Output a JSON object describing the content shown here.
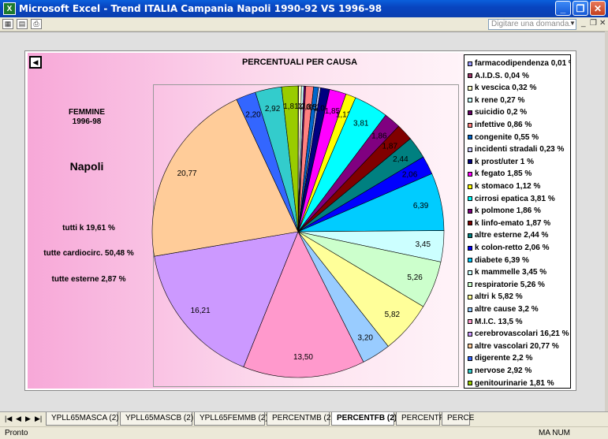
{
  "window": {
    "app_icon": "excel-icon",
    "title": "Microsoft Excel - Trend ITALIA Campania Napoli 1990-92 VS 1996-98",
    "buttons": [
      "minimize-icon",
      "restore-icon",
      "close-icon"
    ]
  },
  "toolbar": {
    "ask_placeholder": "Digitare una domanda.",
    "icons": [
      "excel-doc-icon",
      "print-preview-icon",
      "print-icon"
    ]
  },
  "chart": {
    "back_symbol": "◀",
    "title": "PERCENTUALI PER CAUSA",
    "sex_label": "FEMMINE",
    "period_label": "1996-98",
    "city": "Napoli",
    "summary": [
      "tutti k 19,61 %",
      "tutte cardiocirc. 50,48 %",
      "tutte esterne 2,87 %"
    ]
  },
  "chart_data": {
    "type": "pie",
    "title": "PERCENTUALI PER CAUSA",
    "slices": [
      {
        "label": "farmacodipendenza 0,01 %",
        "value": 0.01,
        "color": "#9999ff",
        "data_label": "0,01"
      },
      {
        "label": "A.I.D.S. 0,04 %",
        "value": 0.04,
        "color": "#993366",
        "data_label": "0,04"
      },
      {
        "label": "k vescica 0,32 %",
        "value": 0.32,
        "color": "#ffffcc",
        "data_label": "0,32"
      },
      {
        "label": "k rene 0,27 %",
        "value": 0.27,
        "color": "#ccffff",
        "data_label": "0,27"
      },
      {
        "label": "suicidio 0,2 %",
        "value": 0.2,
        "color": "#660066",
        "data_label": "0,20"
      },
      {
        "label": "infettive 0,86 %",
        "value": 0.86,
        "color": "#ff8080",
        "data_label": "0,86"
      },
      {
        "label": "congenite 0,55 %",
        "value": 0.55,
        "color": "#0066cc",
        "data_label": "0,55"
      },
      {
        "label": "incidenti stradali 0,23 %",
        "value": 0.23,
        "color": "#ccccff",
        "data_label": "0,23"
      },
      {
        "label": "k prost/uter 1 %",
        "value": 1.0,
        "color": "#000080",
        "data_label": "1,00"
      },
      {
        "label": "k fegato 1,85 %",
        "value": 1.85,
        "color": "#ff00ff",
        "data_label": "1,85"
      },
      {
        "label": "k stomaco 1,12 %",
        "value": 1.12,
        "color": "#ffff00",
        "data_label": "1,12"
      },
      {
        "label": "cirrosi epatica 3,81 %",
        "value": 3.81,
        "color": "#00ffff",
        "data_label": "3,81"
      },
      {
        "label": "k polmone 1,86 %",
        "value": 1.86,
        "color": "#800080",
        "data_label": "1,86"
      },
      {
        "label": "k linfo-emato 1,87 %",
        "value": 1.87,
        "color": "#800000",
        "data_label": "1,87"
      },
      {
        "label": "altre esterne 2,44 %",
        "value": 2.44,
        "color": "#008080",
        "data_label": "2,44"
      },
      {
        "label": "k colon-retto 2,06 %",
        "value": 2.06,
        "color": "#0000ff",
        "data_label": "2,06"
      },
      {
        "label": "diabete 6,39 %",
        "value": 6.39,
        "color": "#00ccff",
        "data_label": "6,39"
      },
      {
        "label": "k mammelle 3,45 %",
        "value": 3.45,
        "color": "#ccffff",
        "data_label": "3,45"
      },
      {
        "label": "respiratorie 5,26 %",
        "value": 5.26,
        "color": "#ccffcc",
        "data_label": "5,26"
      },
      {
        "label": "altri k 5,82 %",
        "value": 5.82,
        "color": "#ffff99",
        "data_label": "5,82"
      },
      {
        "label": "altre cause 3,2 %",
        "value": 3.2,
        "color": "#99ccff",
        "data_label": "3,20"
      },
      {
        "label": "M.I.C. 13,5 %",
        "value": 13.5,
        "color": "#ff99cc",
        "data_label": "13,50"
      },
      {
        "label": "cerebrovascolari 16,21 %",
        "value": 16.21,
        "color": "#cc99ff",
        "data_label": "16,21"
      },
      {
        "label": "altre vascolari 20,77 %",
        "value": 20.77,
        "color": "#ffcc99",
        "data_label": "20,77"
      },
      {
        "label": "digerente 2,2 %",
        "value": 2.2,
        "color": "#3366ff",
        "data_label": "2,20"
      },
      {
        "label": "nervose 2,92 %",
        "value": 2.92,
        "color": "#33cccc",
        "data_label": "2,92"
      },
      {
        "label": "genitourinarie 1,81 %",
        "value": 1.81,
        "color": "#99cc00",
        "data_label": "1,81"
      }
    ]
  },
  "sheet_tabs": [
    "YPLL65MASCA (2)",
    "YPLL65MASCB (2)",
    "YPLL65FEMMB (2)",
    "PERCENTMB (2)",
    "PERCENTFB (2)",
    "PERCENTFB",
    "PERCE"
  ],
  "active_tab": "PERCENTFB (2)",
  "status": {
    "left": "Pronto",
    "right": "MA NUM"
  }
}
